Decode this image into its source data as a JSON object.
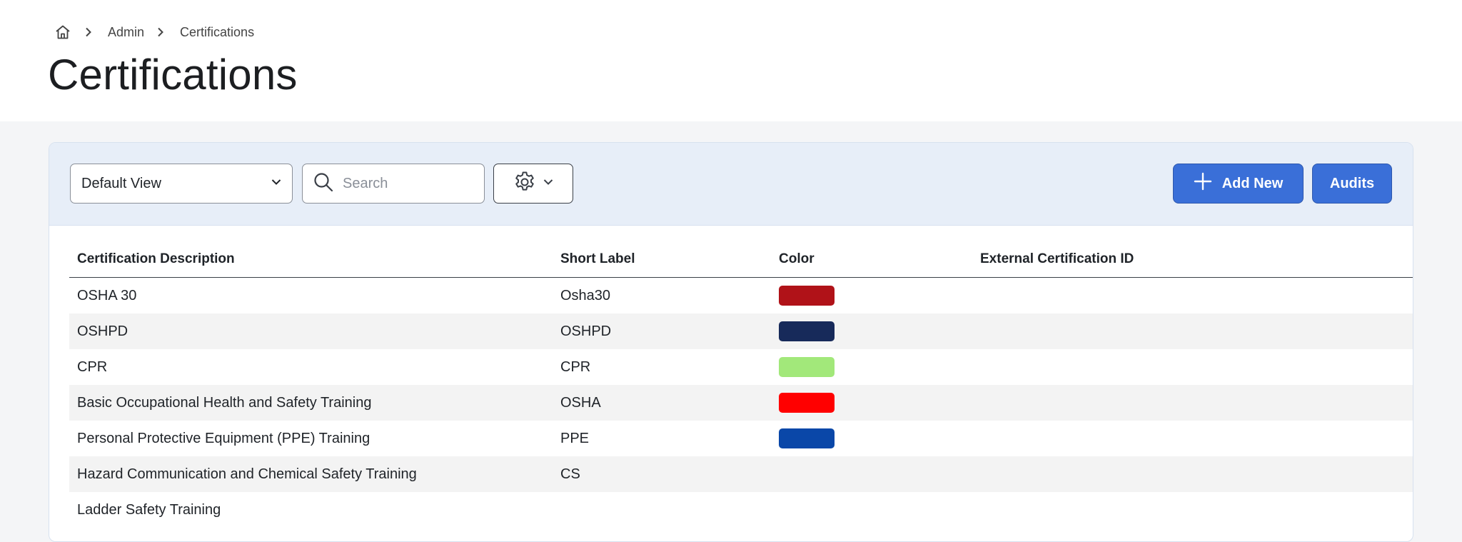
{
  "breadcrumb": {
    "home_icon": "home-icon",
    "items": [
      "Admin",
      "Certifications"
    ]
  },
  "page_title": "Certifications",
  "toolbar": {
    "view_select": {
      "value": "Default View"
    },
    "search": {
      "placeholder": "Search",
      "value": ""
    },
    "settings_icon": "gear-icon",
    "add_new_label": "Add New",
    "audits_label": "Audits"
  },
  "colors": {
    "accent": "#3a6fd8",
    "toolbar_bg": "#e7eef8"
  },
  "table": {
    "columns": [
      "Certification Description",
      "Short Label",
      "Color",
      "External Certification ID"
    ],
    "rows": [
      {
        "description": "OSHA 30",
        "short_label": "Osha30",
        "color": "#b01218",
        "external_id": ""
      },
      {
        "description": "OSHPD",
        "short_label": "OSHPD",
        "color": "#172a5a",
        "external_id": ""
      },
      {
        "description": "CPR",
        "short_label": "CPR",
        "color": "#a2e87a",
        "external_id": ""
      },
      {
        "description": "Basic Occupational Health and Safety Training",
        "short_label": "OSHA",
        "color": "#ff0000",
        "external_id": ""
      },
      {
        "description": "Personal Protective Equipment (PPE) Training",
        "short_label": "PPE",
        "color": "#0a47a8",
        "external_id": ""
      },
      {
        "description": "Hazard Communication and Chemical Safety Training",
        "short_label": "CS",
        "color": "",
        "external_id": ""
      },
      {
        "description": "Ladder Safety Training",
        "short_label": "",
        "color": "",
        "external_id": ""
      }
    ]
  }
}
